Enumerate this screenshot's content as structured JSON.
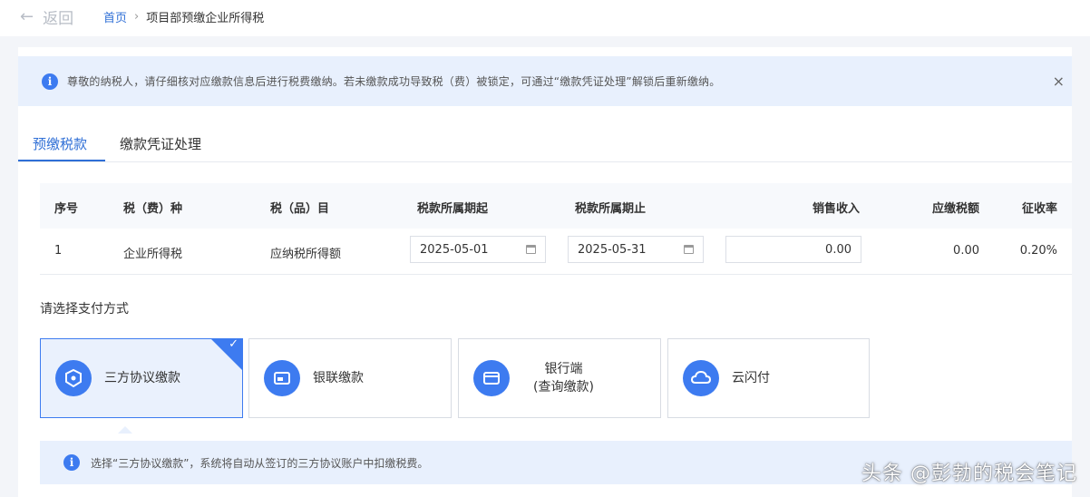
{
  "topbar": {
    "back_label": "返回",
    "breadcrumb_home": "首页",
    "breadcrumb_sep": "›",
    "breadcrumb_current": "项目部预缴企业所得税"
  },
  "notice": {
    "text": "尊敬的纳税人，请仔细核对应缴款信息后进行税费缴纳。若未缴款成功导致税（费）被锁定，可通过“缴款凭证处理”解锁后重新缴纳。",
    "close": "×"
  },
  "tabs": [
    {
      "label": "预缴税款"
    },
    {
      "label": "缴款凭证处理"
    }
  ],
  "table": {
    "headers": [
      "序号",
      "税（费）种",
      "税（品）目",
      "税款所属期起",
      "税款所属期止",
      "销售收入",
      "应缴税额",
      "征收率"
    ],
    "row": {
      "index": "1",
      "tax_type": "企业所得税",
      "tax_item": "应纳税所得额",
      "period_start": "2025-05-01",
      "period_end": "2025-05-31",
      "sales_income": "0.00",
      "tax_due": "0.00",
      "rate": "0.20%"
    }
  },
  "payment": {
    "title": "请选择支付方式",
    "options": [
      {
        "label": "三方协议缴款",
        "icon": "shield-icon",
        "selected": true
      },
      {
        "label": "银联缴款",
        "icon": "unionpay-card-icon",
        "selected": false
      },
      {
        "label_line1": "银行端",
        "label_line2": "(查询缴款)",
        "icon": "bank-card-icon",
        "selected": false
      },
      {
        "label": "云闪付",
        "icon": "cloud-pay-icon",
        "selected": false
      }
    ],
    "check": "✓",
    "note": "选择“三方协议缴款”，系统将自动从签订的三方协议账户中扣缴税费。"
  },
  "watermark": "头条 @彭勃的税会笔记",
  "colors": {
    "accent": "#3d7bf0",
    "notice_bg": "#e8f0fd",
    "link": "#2f6fd6"
  }
}
